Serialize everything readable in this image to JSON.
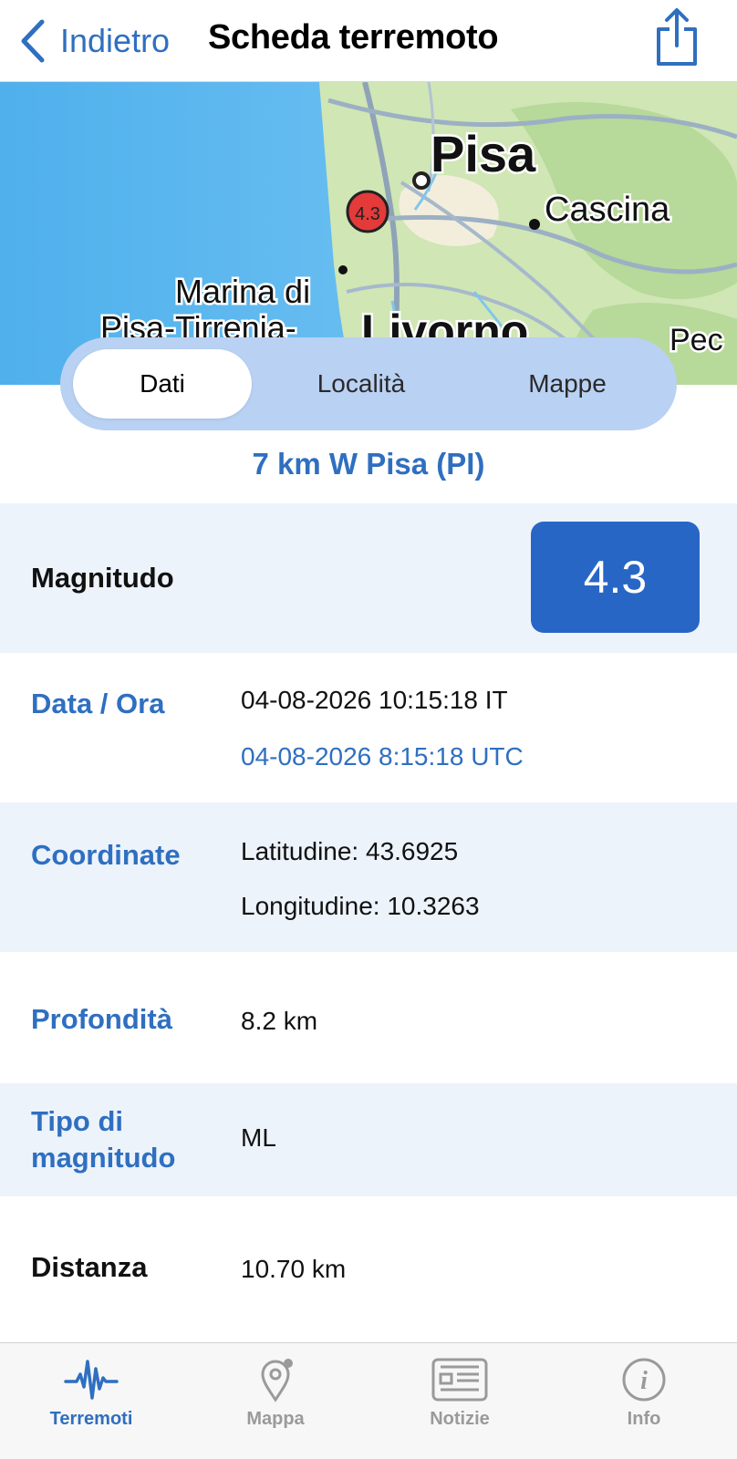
{
  "header": {
    "back_label": "Indietro",
    "title": "Scheda terremoto"
  },
  "map": {
    "city_pisa": "Pisa",
    "city_cascina": "Cascina",
    "city_marina_1": "Marina di",
    "city_marina_2": "Pisa-Tirrenia-",
    "city_livorno": "Livorno",
    "city_pec": "Pec",
    "marker_label": "4.3",
    "colors": {
      "sea": "#5ab6ee",
      "land": "#cfe6b3",
      "marker": "#e43a3a"
    }
  },
  "segments": {
    "dati": "Dati",
    "localita": "Località",
    "mappe": "Mappe"
  },
  "place_title": "7 km W Pisa (PI)",
  "rows": {
    "magnitudo": {
      "label": "Magnitudo",
      "value": "4.3"
    },
    "data_ora": {
      "label": "Data / Ora",
      "local": "04-08-2026 10:15:18 IT",
      "utc": "04-08-2026 8:15:18 UTC"
    },
    "coordinate": {
      "label": "Coordinate",
      "lat": "Latitudine: 43.6925",
      "lon": "Longitudine: 10.3263"
    },
    "profondita": {
      "label": "Profondità",
      "value": "8.2 km"
    },
    "tipo": {
      "label_1": "Tipo di",
      "label_2": "magnitudo",
      "value": "ML"
    },
    "distanza": {
      "label": "Distanza",
      "value": "10.70 km"
    }
  },
  "tabbar": {
    "terremoti": "Terremoti",
    "mappa": "Mappa",
    "notizie": "Notizie",
    "info": "Info"
  },
  "colors": {
    "accent": "#2f6fc0",
    "magnitude_box": "#2866c5",
    "row_alt": "#edf3fb",
    "segment_bg": "#b9d1f3"
  }
}
